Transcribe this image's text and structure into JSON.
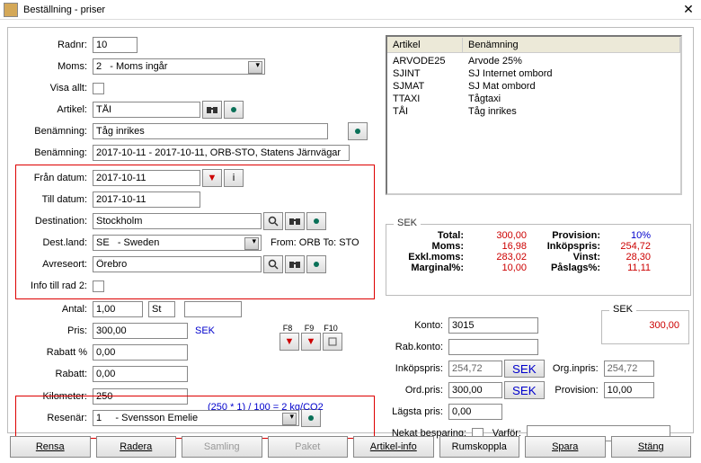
{
  "window": {
    "title": "Beställning - priser"
  },
  "left": {
    "radnr_label": "Radnr:",
    "radnr": "10",
    "moms_label": "Moms:",
    "moms": "2   - Moms ingår",
    "visa_label": "Visa allt:",
    "artikel_label": "Artikel:",
    "artikel": "TÅI",
    "benamning_label": "Benämning:",
    "benamning": "Tåg inrikes",
    "benamning2_label": "Benämning:",
    "benamning2": "2017-10-11 - 2017-10-11, ORB-STO, Statens Järnvägar",
    "fran_label": "Från datum:",
    "fran": "2017-10-11",
    "till_label": "Till datum:",
    "till": "2017-10-11",
    "dest_label": "Destination:",
    "dest": "Stockholm",
    "destland_label": "Dest.land:",
    "destland": "SE   - Sweden",
    "fromto": "From: ORB To: STO",
    "avreseort_label": "Avreseort:",
    "avreseort": "Örebro",
    "info_label": "Info till rad 2:",
    "antal_label": "Antal:",
    "antal": "1,00",
    "antal_unit": "St",
    "pris_label": "Pris:",
    "pris": "300,00",
    "pris_cur": "SEK",
    "rabattp_label": "Rabatt %",
    "rabattp": "0,00",
    "rabatt_label": "Rabatt:",
    "rabatt": "0,00",
    "km_label": "Kilometer:",
    "km": "250",
    "co2": "(250 * 1) / 100 = 2 kg/CO2",
    "resenar_label": "Resenär:",
    "resenar": "1     - Svensson Emelie"
  },
  "articles": {
    "col1": "Artikel",
    "col2": "Benämning",
    "rows": [
      {
        "a": "ARVODE25",
        "b": "Arvode 25%"
      },
      {
        "a": "SJINT",
        "b": "SJ Internet ombord"
      },
      {
        "a": "SJMAT",
        "b": "SJ Mat ombord"
      },
      {
        "a": "TTAXI",
        "b": "Tågtaxi"
      },
      {
        "a": "TÅI",
        "b": "Tåg inrikes"
      }
    ]
  },
  "sek": {
    "legend": "SEK",
    "total_k": "Total:",
    "total_v": "300,00",
    "provision_k": "Provision:",
    "provision_v": "10%",
    "moms_k": "Moms:",
    "moms_v": "16,98",
    "inkopspris_k": "Inköpspris:",
    "inkopspris_v": "254,72",
    "exklmoms_k": "Exkl.moms:",
    "exklmoms_v": "283,02",
    "vinst_k": "Vinst:",
    "vinst_v": "28,30",
    "marginal_k": "Marginal%:",
    "marginal_v": "10,00",
    "paslag_k": "Påslags%:",
    "paslag_v": "11,11"
  },
  "sek_mini": {
    "legend": "SEK",
    "value": "300,00"
  },
  "right": {
    "konto_label": "Konto:",
    "konto": "3015",
    "rabkonto_label": "Rab.konto:",
    "rabkonto": "",
    "inkopspris_label": "Inköpspris:",
    "inkopspris": "254,72",
    "sek_btn": "SEK",
    "orginpris_label": "Org.inpris:",
    "orginpris": "254,72",
    "ordpris_label": "Ord.pris:",
    "ordpris": "300,00",
    "provision_label": "Provision:",
    "provision": "10,00",
    "lagsta_label": "Lägsta pris:",
    "lagsta": "0,00",
    "nekat_label": "Nekat besparing:",
    "varfor_label": "Varför:"
  },
  "fkeys": {
    "f8": "F8",
    "f9": "F9",
    "f10": "F10"
  },
  "buttons": {
    "rensa": "Rensa",
    "radera": "Radera",
    "samling": "Samling",
    "paket": "Paket",
    "artikelinfo": "Artikel-info",
    "rumskoppla": "Rumskoppla",
    "spara": "Spara",
    "stang": "Stäng"
  }
}
